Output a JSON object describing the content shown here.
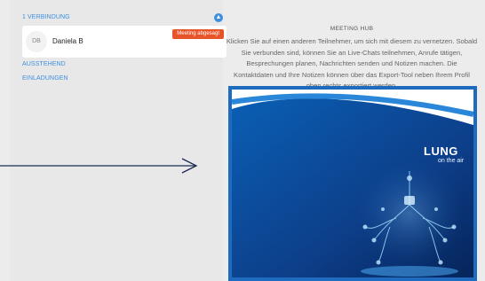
{
  "connections": {
    "header": "1 VERBINDUNG",
    "collapse_icon": "chevron-up-icon",
    "contact": {
      "initials": "DB",
      "name": "Daniela B",
      "status": "Meeting abgesagt"
    }
  },
  "pending": {
    "header": "AUSSTEHEND"
  },
  "invites": {
    "header": "EINLADUNGEN"
  },
  "hub": {
    "title": "MEETING HUB",
    "text": "Klicken Sie auf einen anderen Teilnehmer, um sich mit diesem zu vernetzen.     Sobald Sie verbunden sind, können Sie an Live-Chats teilnehmen, Anrufe tätigen, Besprechungen planen, Nachrichten senden und Notizen machen. Die Kontaktdaten und Ihre Notizen können über das Export-Tool neben Ihrem Profil oben rechts exportiert werden."
  },
  "video": {
    "title": "LUNG",
    "subtitle": "on the air"
  },
  "colors": {
    "accent": "#3e8fe0",
    "badge": "#e8542a",
    "frame": "#1f6bbf"
  }
}
